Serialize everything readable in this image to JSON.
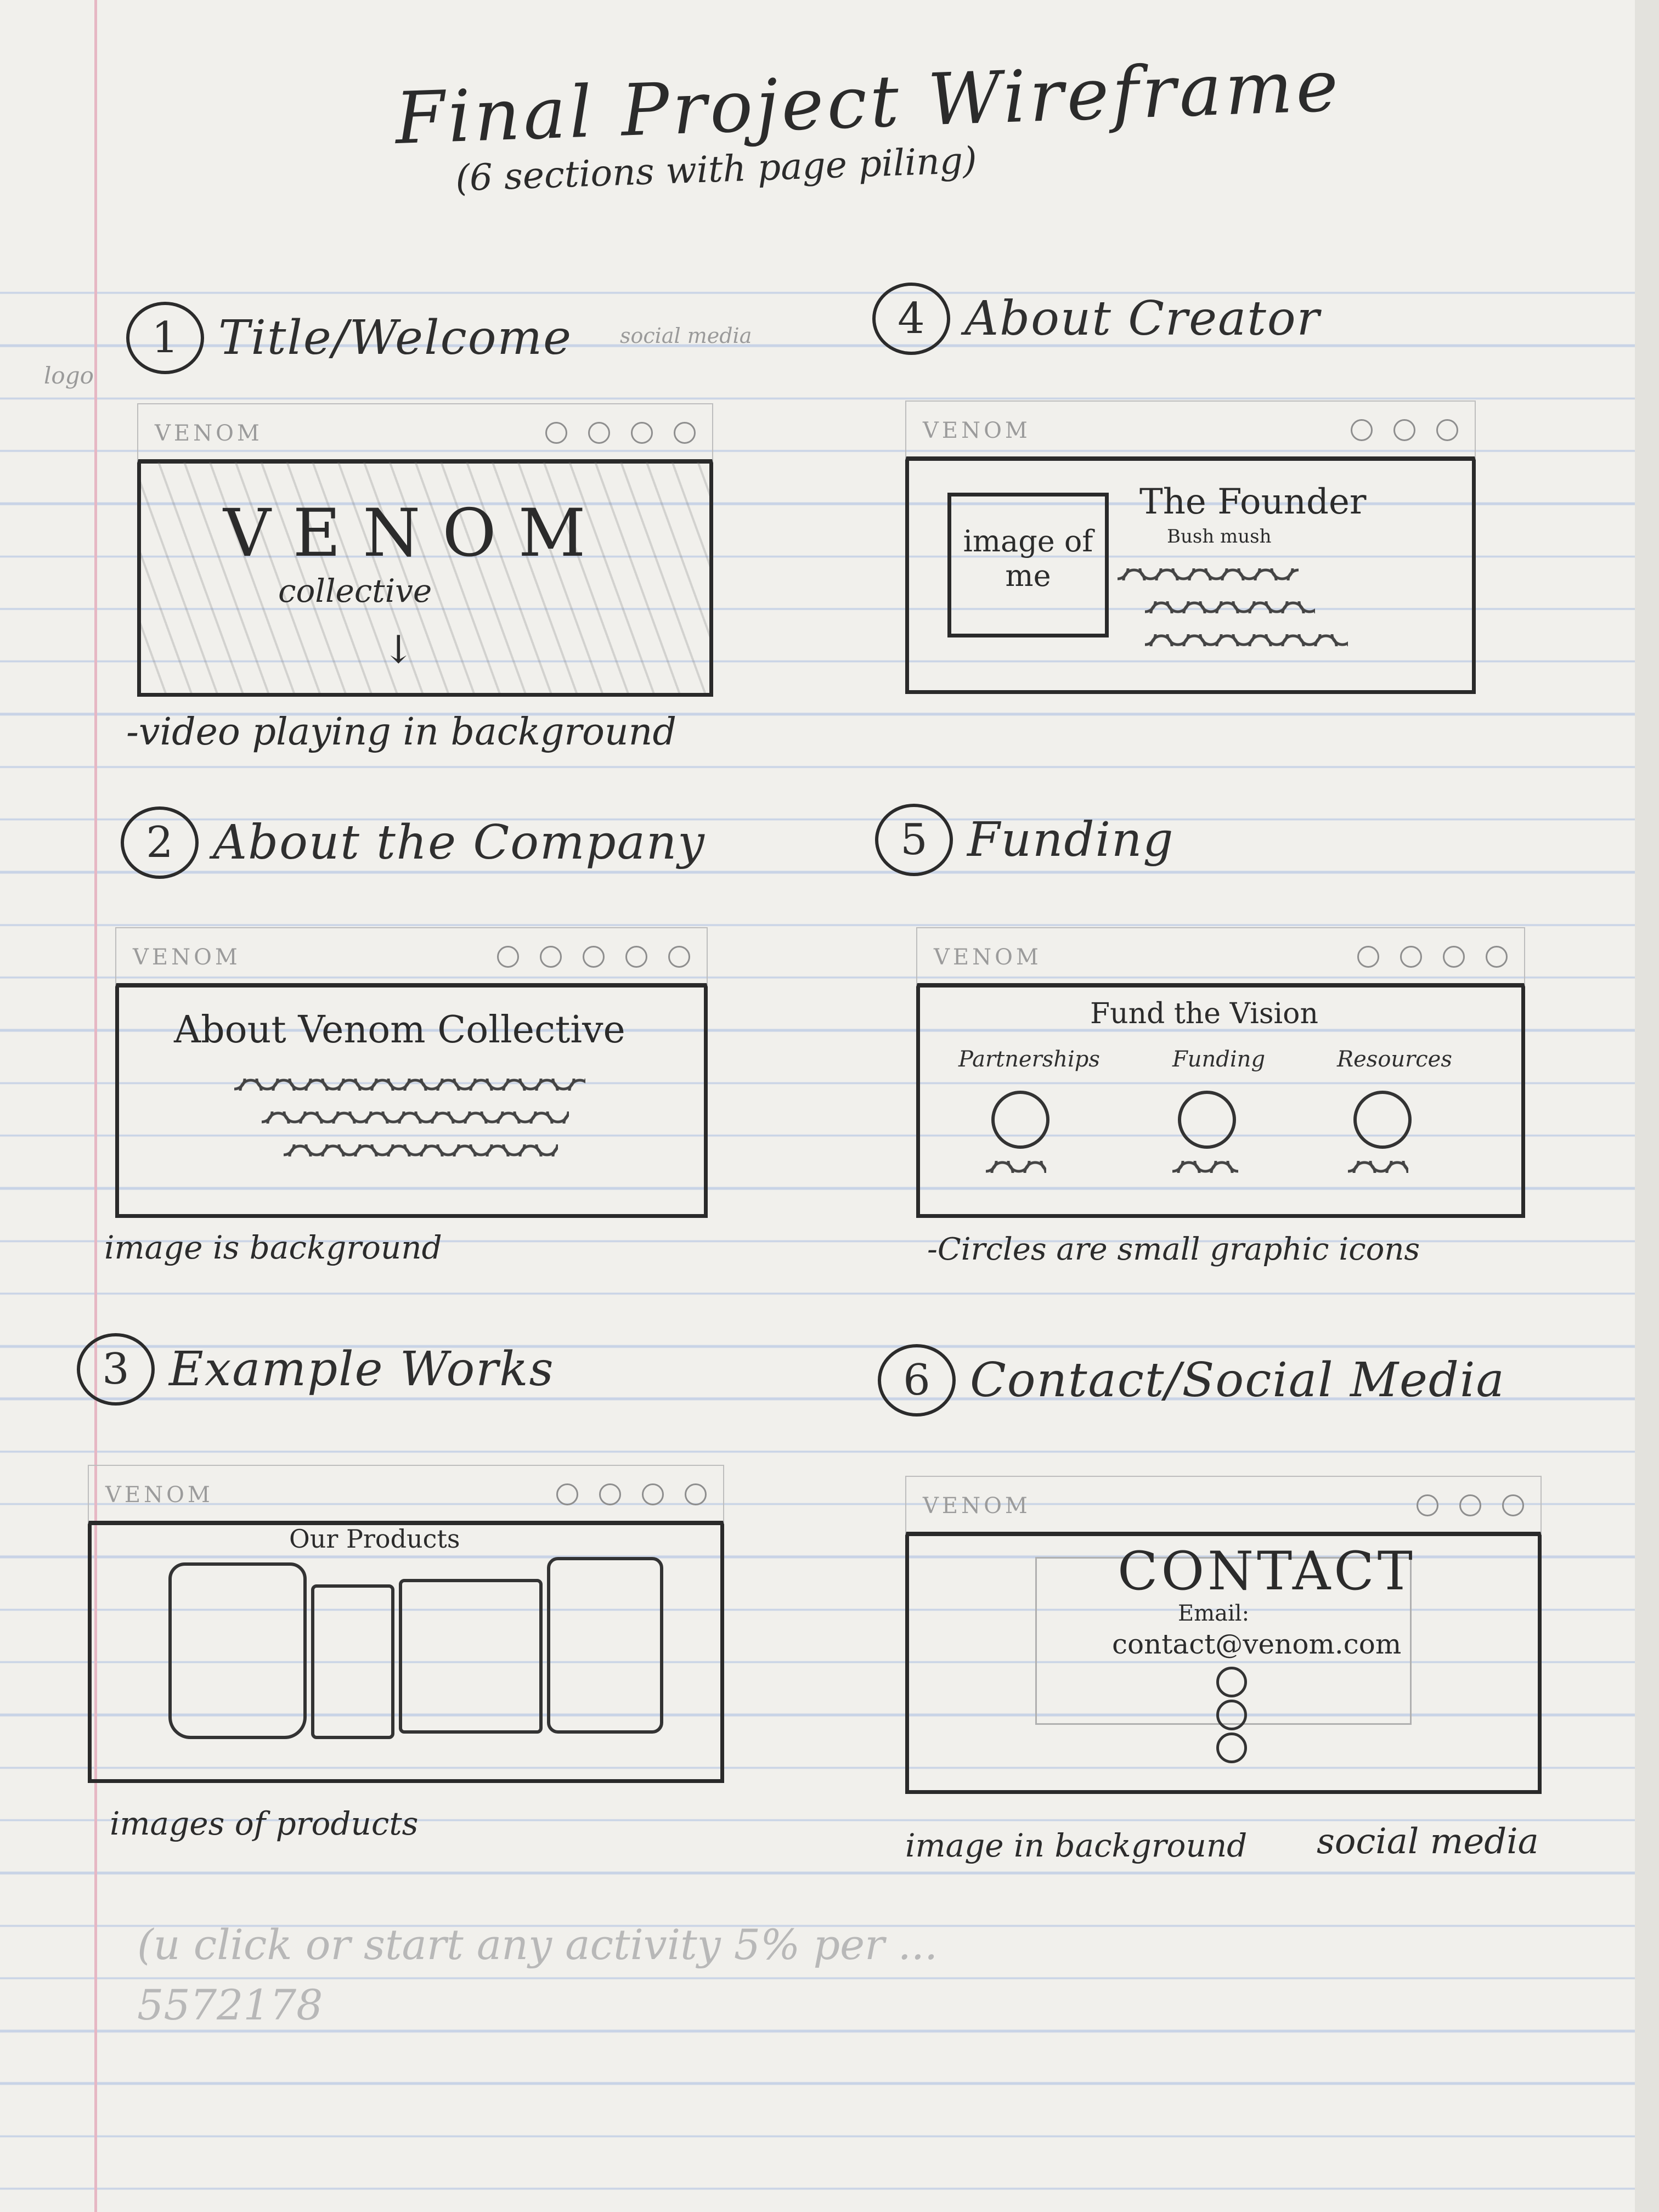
{
  "page": {
    "title": "Final Project Wireframe",
    "subtitle": "(6 sections with page piling)"
  },
  "sections": [
    {
      "number": "1",
      "heading": "Title/Welcome",
      "logo": "VENOM",
      "hero_title": "VENOM",
      "hero_subtitle": "collective",
      "scroll_arrow": "↓",
      "annotation_logo": "logo",
      "annotation_social": "social media",
      "note": "-video playing in background"
    },
    {
      "number": "2",
      "heading": "About the Company",
      "logo": "VENOM",
      "content_title": "About Venom Collective",
      "note": "image is background"
    },
    {
      "number": "3",
      "heading": "Example Works",
      "logo": "VENOM",
      "content_title": "Our Products",
      "note": "images of products"
    },
    {
      "number": "4",
      "heading": "About Creator",
      "logo": "VENOM",
      "image_label": "image of me",
      "content_title": "The Founder",
      "content_subtitle": "Bush mush"
    },
    {
      "number": "5",
      "heading": "Funding",
      "logo": "VENOM",
      "content_title": "Fund the Vision",
      "columns": [
        "Partnerships",
        "Funding",
        "Resources"
      ],
      "note": "-Circles are small graphic icons"
    },
    {
      "number": "6",
      "heading": "Contact/Social Media",
      "logo": "VENOM",
      "content_title": "CONTACT",
      "email_label": "Email:",
      "email": "contact@venom.com",
      "note_left": "image in background",
      "note_right": "social media"
    }
  ],
  "faded_writing": {
    "line1": "(u click or start any activity 5% per ...",
    "line2": "5572178"
  },
  "colors": {
    "paper": "#f1f0ec",
    "rule_line": "#c8d3e6",
    "margin_line": "#e6b7c4",
    "ink": "#2b2b2b"
  }
}
